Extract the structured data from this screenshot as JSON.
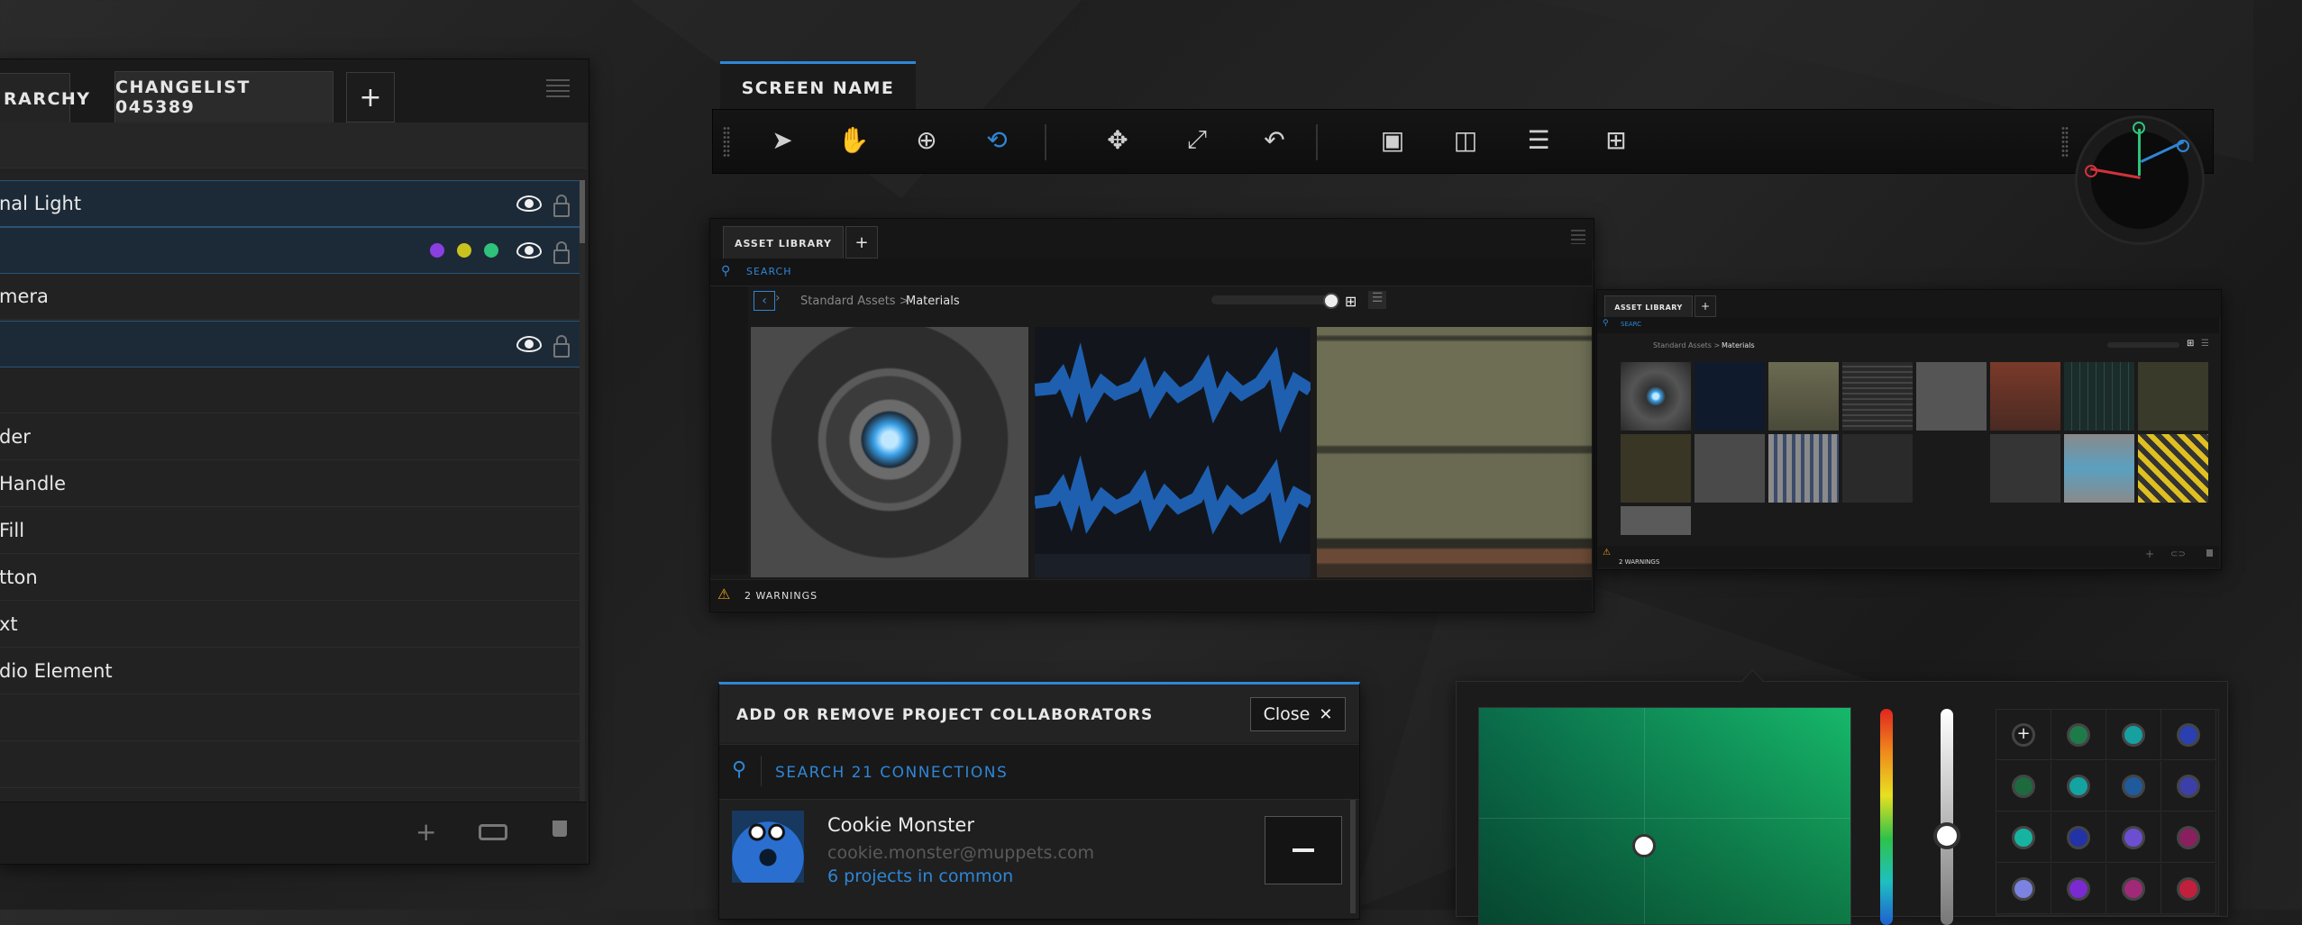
{
  "hierarchy": {
    "tabs": [
      "RARCHY",
      "CHANGELIST 045389"
    ],
    "add_tab": "+",
    "rows": [
      {
        "label": "nal Light",
        "selected": true,
        "eye": true,
        "lock": true,
        "dots": []
      },
      {
        "label": "",
        "selected": true,
        "eye": true,
        "lock": true,
        "dots": [
          "#8a3fe0",
          "#c9c21e",
          "#2ec27a"
        ]
      },
      {
        "label": "mera",
        "selected": false,
        "eye": false,
        "lock": false,
        "dots": []
      },
      {
        "label": "",
        "selected": true,
        "eye": true,
        "lock": true,
        "dots": []
      },
      {
        "label": "",
        "selected": false,
        "eye": false,
        "lock": false,
        "dots": []
      },
      {
        "label": "der",
        "selected": false,
        "eye": false,
        "lock": false,
        "dots": []
      },
      {
        "label": " Handle",
        "selected": false,
        "eye": false,
        "lock": false,
        "dots": []
      },
      {
        "label": " Fill",
        "selected": false,
        "eye": false,
        "lock": false,
        "dots": []
      },
      {
        "label": "tton",
        "selected": false,
        "eye": false,
        "lock": false,
        "dots": []
      },
      {
        "label": "xt",
        "selected": false,
        "eye": false,
        "lock": false,
        "dots": []
      },
      {
        "label": "dio Element",
        "selected": false,
        "eye": false,
        "lock": false,
        "dots": []
      },
      {
        "label": "",
        "selected": false,
        "eye": false,
        "lock": false,
        "dots": []
      },
      {
        "label": "",
        "selected": false,
        "eye": false,
        "lock": false,
        "dots": []
      }
    ],
    "footer_icons": [
      "plus-icon",
      "link-icon",
      "trash-icon"
    ]
  },
  "screen": {
    "tab_label": "SCREEN NAME",
    "tools": [
      {
        "name": "pointer-icon",
        "glyph": "➤",
        "active": false
      },
      {
        "name": "hand-icon",
        "glyph": "✋",
        "active": false
      },
      {
        "name": "zoom-in-icon",
        "glyph": "⊕",
        "active": false
      },
      {
        "name": "orbit-icon",
        "glyph": "⟲",
        "active": true
      },
      {
        "name": "move-icon",
        "glyph": "✥",
        "active": false
      },
      {
        "name": "scale-icon",
        "glyph": "⤢",
        "active": false
      },
      {
        "name": "rotate-icon",
        "glyph": "↶",
        "active": false
      },
      {
        "name": "layout-single-icon",
        "glyph": "▣",
        "active": false
      },
      {
        "name": "layout-columns-icon",
        "glyph": "◫",
        "active": false
      },
      {
        "name": "layout-rows-icon",
        "glyph": "☰",
        "active": false
      },
      {
        "name": "layout-grid-icon",
        "glyph": "⊞",
        "active": false
      }
    ],
    "accent": "#2f86d6"
  },
  "asset_library": {
    "tab_label": "ASSET LIBRARY",
    "add_tab": "+",
    "search_placeholder": "SEARCH",
    "breadcrumb_root": "Standard Assets >",
    "breadcrumb_current": "Materials",
    "warnings": "2 WARNINGS"
  },
  "asset_library_small": {
    "tab_label": "ASSET LIBRARY",
    "add_tab": "+",
    "search_placeholder": "SEARC",
    "breadcrumb_root": "Standard Assets >",
    "breadcrumb_current": "Materials",
    "warnings": "2 WARNINGS"
  },
  "collaborators": {
    "title": "ADD OR REMOVE PROJECT COLLABORATORS",
    "close_label": "Close",
    "search_placeholder": "SEARCH 21 CONNECTIONS",
    "user": {
      "name": "Cookie Monster",
      "email": "cookie.monster@muppets.com",
      "common": "6 projects in common"
    },
    "remove_label": "—"
  },
  "color_picker": {
    "swatches": [
      [
        "add",
        "#1f7a4a",
        "#16a0a0",
        "#2a3fb0"
      ],
      [
        "#1c6a3e",
        "#13a3a0",
        "#1f5a9c",
        "#3c3fa8"
      ],
      [
        "#16b3a0",
        "#2233a8",
        "#6b4fd0",
        "#8a1f60"
      ],
      [
        "#7c82e0",
        "#7a2ad0",
        "#a02a78",
        "#c0203c"
      ]
    ],
    "add_glyph": "+"
  }
}
